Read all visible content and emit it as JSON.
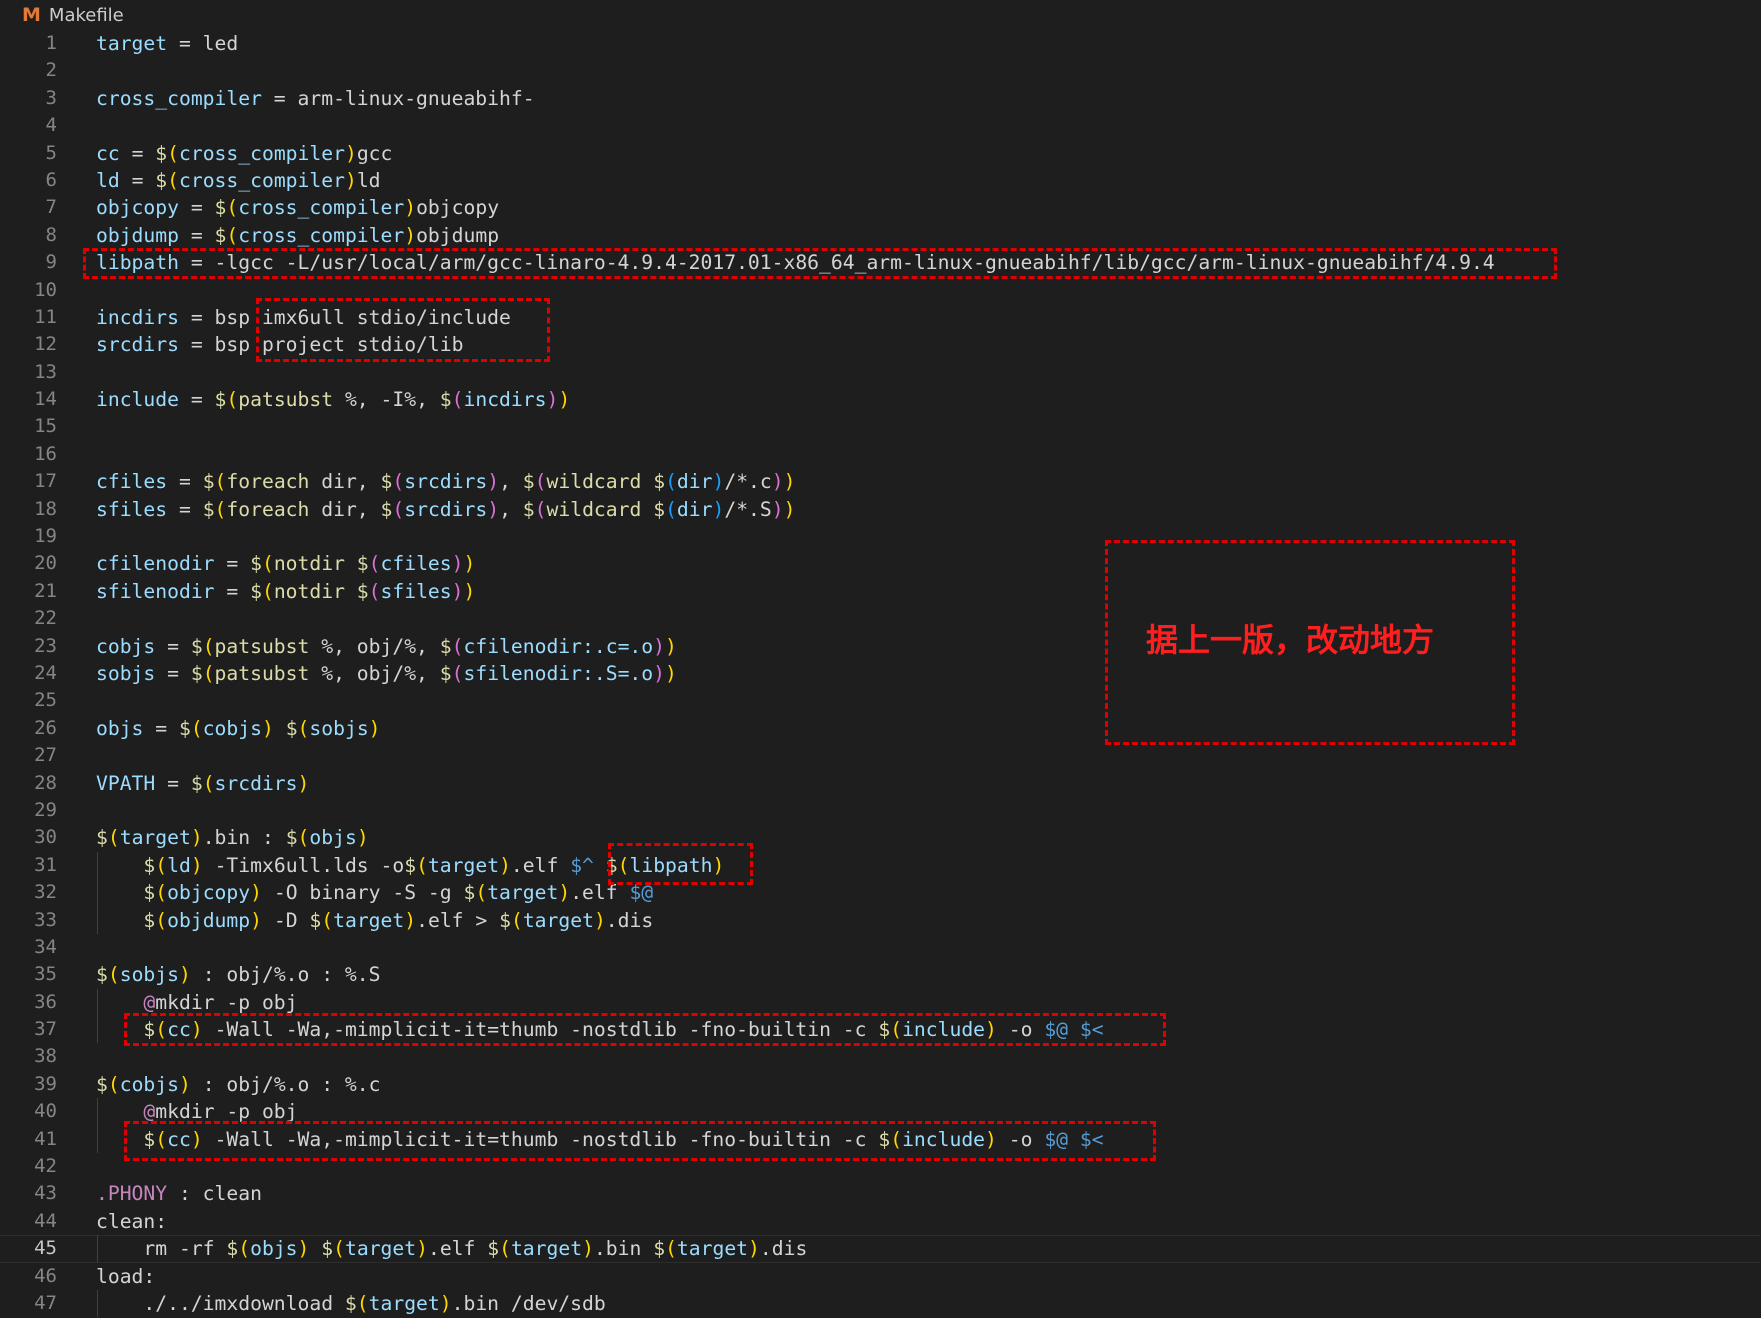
{
  "tab": {
    "icon": "makefile-icon",
    "icon_glyph": "M",
    "filename": "Makefile"
  },
  "annotation": {
    "note_text": "据上一版，改动地方"
  },
  "lines": [
    [
      [
        "target",
        "var"
      ],
      [
        " = led",
        "txt"
      ]
    ],
    [],
    [
      [
        "cross_compiler",
        "var"
      ],
      [
        " = arm-linux-gnueabihf-",
        "txt"
      ]
    ],
    [],
    [
      [
        "cc",
        "var"
      ],
      [
        " = ",
        "txt"
      ],
      [
        "$",
        "dol"
      ],
      [
        "(",
        "p1"
      ],
      [
        "cross_compiler",
        "var"
      ],
      [
        ")",
        "p1"
      ],
      [
        "gcc",
        "txt"
      ]
    ],
    [
      [
        "ld",
        "var"
      ],
      [
        " = ",
        "txt"
      ],
      [
        "$",
        "dol"
      ],
      [
        "(",
        "p1"
      ],
      [
        "cross_compiler",
        "var"
      ],
      [
        ")",
        "p1"
      ],
      [
        "ld",
        "txt"
      ]
    ],
    [
      [
        "objcopy",
        "var"
      ],
      [
        " = ",
        "txt"
      ],
      [
        "$",
        "dol"
      ],
      [
        "(",
        "p1"
      ],
      [
        "cross_compiler",
        "var"
      ],
      [
        ")",
        "p1"
      ],
      [
        "objcopy",
        "txt"
      ]
    ],
    [
      [
        "objdump",
        "var"
      ],
      [
        " = ",
        "txt"
      ],
      [
        "$",
        "dol"
      ],
      [
        "(",
        "p1"
      ],
      [
        "cross_compiler",
        "var"
      ],
      [
        ")",
        "p1"
      ],
      [
        "objdump",
        "txt"
      ]
    ],
    [
      [
        "libpath",
        "var"
      ],
      [
        " = -lgcc -L/usr/local/arm/gcc-linaro-4.9.4-2017.01-x86_64_arm-linux-gnueabihf/lib/gcc/arm-linux-gnueabihf/4.9.4",
        "txt"
      ]
    ],
    [],
    [
      [
        "incdirs",
        "var"
      ],
      [
        " = bsp imx6ull stdio/include",
        "txt"
      ]
    ],
    [
      [
        "srcdirs",
        "var"
      ],
      [
        " = bsp project stdio/lib",
        "txt"
      ]
    ],
    [],
    [
      [
        "include",
        "var"
      ],
      [
        " = ",
        "txt"
      ],
      [
        "$",
        "dol"
      ],
      [
        "(",
        "p1"
      ],
      [
        "patsubst",
        "fn"
      ],
      [
        " %, -I%, ",
        "txt"
      ],
      [
        "$",
        "dol"
      ],
      [
        "(",
        "p2"
      ],
      [
        "incdirs",
        "var"
      ],
      [
        ")",
        "p2"
      ],
      [
        ")",
        "p1"
      ]
    ],
    [],
    [],
    [
      [
        "cfiles",
        "var"
      ],
      [
        " = ",
        "txt"
      ],
      [
        "$",
        "dol"
      ],
      [
        "(",
        "p1"
      ],
      [
        "foreach",
        "fn"
      ],
      [
        " dir, ",
        "txt"
      ],
      [
        "$",
        "dol"
      ],
      [
        "(",
        "p2"
      ],
      [
        "srcdirs",
        "var"
      ],
      [
        ")",
        "p2"
      ],
      [
        ", ",
        "txt"
      ],
      [
        "$",
        "dol"
      ],
      [
        "(",
        "p2"
      ],
      [
        "wildcard",
        "fn"
      ],
      [
        " ",
        "txt"
      ],
      [
        "$",
        "dol"
      ],
      [
        "(",
        "p3"
      ],
      [
        "dir",
        "var"
      ],
      [
        ")",
        "p3"
      ],
      [
        "/*.c",
        "txt"
      ],
      [
        ")",
        "p2"
      ],
      [
        ")",
        "p1"
      ]
    ],
    [
      [
        "sfiles",
        "var"
      ],
      [
        " = ",
        "txt"
      ],
      [
        "$",
        "dol"
      ],
      [
        "(",
        "p1"
      ],
      [
        "foreach",
        "fn"
      ],
      [
        " dir, ",
        "txt"
      ],
      [
        "$",
        "dol"
      ],
      [
        "(",
        "p2"
      ],
      [
        "srcdirs",
        "var"
      ],
      [
        ")",
        "p2"
      ],
      [
        ", ",
        "txt"
      ],
      [
        "$",
        "dol"
      ],
      [
        "(",
        "p2"
      ],
      [
        "wildcard",
        "fn"
      ],
      [
        " ",
        "txt"
      ],
      [
        "$",
        "dol"
      ],
      [
        "(",
        "p3"
      ],
      [
        "dir",
        "var"
      ],
      [
        ")",
        "p3"
      ],
      [
        "/*.S",
        "txt"
      ],
      [
        ")",
        "p2"
      ],
      [
        ")",
        "p1"
      ]
    ],
    [],
    [
      [
        "cfilenodir",
        "var"
      ],
      [
        " = ",
        "txt"
      ],
      [
        "$",
        "dol"
      ],
      [
        "(",
        "p1"
      ],
      [
        "notdir",
        "fn"
      ],
      [
        " ",
        "txt"
      ],
      [
        "$",
        "dol"
      ],
      [
        "(",
        "p2"
      ],
      [
        "cfiles",
        "var"
      ],
      [
        ")",
        "p2"
      ],
      [
        ")",
        "p1"
      ]
    ],
    [
      [
        "sfilenodir",
        "var"
      ],
      [
        " = ",
        "txt"
      ],
      [
        "$",
        "dol"
      ],
      [
        "(",
        "p1"
      ],
      [
        "notdir",
        "fn"
      ],
      [
        " ",
        "txt"
      ],
      [
        "$",
        "dol"
      ],
      [
        "(",
        "p2"
      ],
      [
        "sfiles",
        "var"
      ],
      [
        ")",
        "p2"
      ],
      [
        ")",
        "p1"
      ]
    ],
    [],
    [
      [
        "cobjs",
        "var"
      ],
      [
        " = ",
        "txt"
      ],
      [
        "$",
        "dol"
      ],
      [
        "(",
        "p1"
      ],
      [
        "patsubst",
        "fn"
      ],
      [
        " %, obj/%, ",
        "txt"
      ],
      [
        "$",
        "dol"
      ],
      [
        "(",
        "p2"
      ],
      [
        "cfilenodir:.c=.o",
        "var"
      ],
      [
        ")",
        "p2"
      ],
      [
        ")",
        "p1"
      ]
    ],
    [
      [
        "sobjs",
        "var"
      ],
      [
        " = ",
        "txt"
      ],
      [
        "$",
        "dol"
      ],
      [
        "(",
        "p1"
      ],
      [
        "patsubst",
        "fn"
      ],
      [
        " %, obj/%, ",
        "txt"
      ],
      [
        "$",
        "dol"
      ],
      [
        "(",
        "p2"
      ],
      [
        "sfilenodir:.S=.o",
        "var"
      ],
      [
        ")",
        "p2"
      ],
      [
        ")",
        "p1"
      ]
    ],
    [],
    [
      [
        "objs",
        "var"
      ],
      [
        " = ",
        "txt"
      ],
      [
        "$",
        "dol"
      ],
      [
        "(",
        "p1"
      ],
      [
        "cobjs",
        "var"
      ],
      [
        ")",
        "p1"
      ],
      [
        " ",
        "txt"
      ],
      [
        "$",
        "dol"
      ],
      [
        "(",
        "p1"
      ],
      [
        "sobjs",
        "var"
      ],
      [
        ")",
        "p1"
      ]
    ],
    [],
    [
      [
        "VPATH",
        "var"
      ],
      [
        " = ",
        "txt"
      ],
      [
        "$",
        "dol"
      ],
      [
        "(",
        "p1"
      ],
      [
        "srcdirs",
        "var"
      ],
      [
        ")",
        "p1"
      ]
    ],
    [],
    [
      [
        "$",
        "dol"
      ],
      [
        "(",
        "p1"
      ],
      [
        "target",
        "var"
      ],
      [
        ")",
        "p1"
      ],
      [
        ".bin : ",
        "txt"
      ],
      [
        "$",
        "dol"
      ],
      [
        "(",
        "p1"
      ],
      [
        "objs",
        "var"
      ],
      [
        ")",
        "p1"
      ]
    ],
    [
      [
        "    ",
        "ind"
      ],
      [
        "$",
        "dol"
      ],
      [
        "(",
        "p1"
      ],
      [
        "ld",
        "var"
      ],
      [
        ")",
        "p1"
      ],
      [
        " -Timx6ull.lds -o",
        "txt"
      ],
      [
        "$",
        "dol"
      ],
      [
        "(",
        "p1"
      ],
      [
        "target",
        "var"
      ],
      [
        ")",
        "p1"
      ],
      [
        ".elf ",
        "txt"
      ],
      [
        "$^",
        "auto"
      ],
      [
        " ",
        "txt"
      ],
      [
        "$",
        "dol"
      ],
      [
        "(",
        "p1"
      ],
      [
        "libpath",
        "var"
      ],
      [
        ")",
        "p1"
      ]
    ],
    [
      [
        "    ",
        "ind"
      ],
      [
        "$",
        "dol"
      ],
      [
        "(",
        "p1"
      ],
      [
        "objcopy",
        "var"
      ],
      [
        ")",
        "p1"
      ],
      [
        " -O binary -S -g ",
        "txt"
      ],
      [
        "$",
        "dol"
      ],
      [
        "(",
        "p1"
      ],
      [
        "target",
        "var"
      ],
      [
        ")",
        "p1"
      ],
      [
        ".elf ",
        "txt"
      ],
      [
        "$@",
        "auto"
      ]
    ],
    [
      [
        "    ",
        "ind"
      ],
      [
        "$",
        "dol"
      ],
      [
        "(",
        "p1"
      ],
      [
        "objdump",
        "var"
      ],
      [
        ")",
        "p1"
      ],
      [
        " -D ",
        "txt"
      ],
      [
        "$",
        "dol"
      ],
      [
        "(",
        "p1"
      ],
      [
        "target",
        "var"
      ],
      [
        ")",
        "p1"
      ],
      [
        ".elf > ",
        "txt"
      ],
      [
        "$",
        "dol"
      ],
      [
        "(",
        "p1"
      ],
      [
        "target",
        "var"
      ],
      [
        ")",
        "p1"
      ],
      [
        ".dis",
        "txt"
      ]
    ],
    [],
    [
      [
        "$",
        "dol"
      ],
      [
        "(",
        "p1"
      ],
      [
        "sobjs",
        "var"
      ],
      [
        ")",
        "p1"
      ],
      [
        " : obj/%.o : %.S",
        "txt"
      ]
    ],
    [
      [
        "    ",
        "ind"
      ],
      [
        "@",
        "ctl"
      ],
      [
        "mkdir -p obj",
        "txt"
      ]
    ],
    [
      [
        "    ",
        "ind"
      ],
      [
        "$",
        "dol"
      ],
      [
        "(",
        "p1"
      ],
      [
        "cc",
        "var"
      ],
      [
        ")",
        "p1"
      ],
      [
        " -Wall -Wa,-mimplicit-it=thumb -nostdlib -fno-builtin -c ",
        "txt"
      ],
      [
        "$",
        "dol"
      ],
      [
        "(",
        "p1"
      ],
      [
        "include",
        "var"
      ],
      [
        ")",
        "p1"
      ],
      [
        " -o ",
        "txt"
      ],
      [
        "$@",
        "auto"
      ],
      [
        " ",
        "txt"
      ],
      [
        "$<",
        "auto"
      ]
    ],
    [],
    [
      [
        "$",
        "dol"
      ],
      [
        "(",
        "p1"
      ],
      [
        "cobjs",
        "var"
      ],
      [
        ")",
        "p1"
      ],
      [
        " : obj/%.o : %.c",
        "txt"
      ]
    ],
    [
      [
        "    ",
        "ind"
      ],
      [
        "@",
        "ctl"
      ],
      [
        "mkdir -p obj",
        "txt"
      ]
    ],
    [
      [
        "    ",
        "ind"
      ],
      [
        "$",
        "dol"
      ],
      [
        "(",
        "p1"
      ],
      [
        "cc",
        "var"
      ],
      [
        ")",
        "p1"
      ],
      [
        " -Wall -Wa,-mimplicit-it=thumb -nostdlib -fno-builtin -c ",
        "txt"
      ],
      [
        "$",
        "dol"
      ],
      [
        "(",
        "p1"
      ],
      [
        "include",
        "var"
      ],
      [
        ")",
        "p1"
      ],
      [
        " -o ",
        "txt"
      ],
      [
        "$@",
        "auto"
      ],
      [
        " ",
        "txt"
      ],
      [
        "$<",
        "auto"
      ]
    ],
    [],
    [
      [
        ".PHONY",
        "kw"
      ],
      [
        " : clean",
        "txt"
      ]
    ],
    [
      [
        "clean:",
        "txt"
      ]
    ],
    [
      [
        "    ",
        "ind"
      ],
      [
        "rm -rf ",
        "txt"
      ],
      [
        "$",
        "dol"
      ],
      [
        "(",
        "p1"
      ],
      [
        "objs",
        "var"
      ],
      [
        ")",
        "p1"
      ],
      [
        " ",
        "txt"
      ],
      [
        "$",
        "dol"
      ],
      [
        "(",
        "p1"
      ],
      [
        "target",
        "var"
      ],
      [
        ")",
        "p1"
      ],
      [
        ".elf ",
        "txt"
      ],
      [
        "$",
        "dol"
      ],
      [
        "(",
        "p1"
      ],
      [
        "target",
        "var"
      ],
      [
        ")",
        "p1"
      ],
      [
        ".bin ",
        "txt"
      ],
      [
        "$",
        "dol"
      ],
      [
        "(",
        "p1"
      ],
      [
        "target",
        "var"
      ],
      [
        ")",
        "p1"
      ],
      [
        ".dis",
        "txt"
      ]
    ],
    [
      [
        "load:",
        "txt"
      ]
    ],
    [
      [
        "    ",
        "ind"
      ],
      [
        "./../imxdownload ",
        "txt"
      ],
      [
        "$",
        "dol"
      ],
      [
        "(",
        "p1"
      ],
      [
        "target",
        "var"
      ],
      [
        ")",
        "p1"
      ],
      [
        ".bin /dev/sdb",
        "txt"
      ]
    ]
  ],
  "current_line": 45
}
